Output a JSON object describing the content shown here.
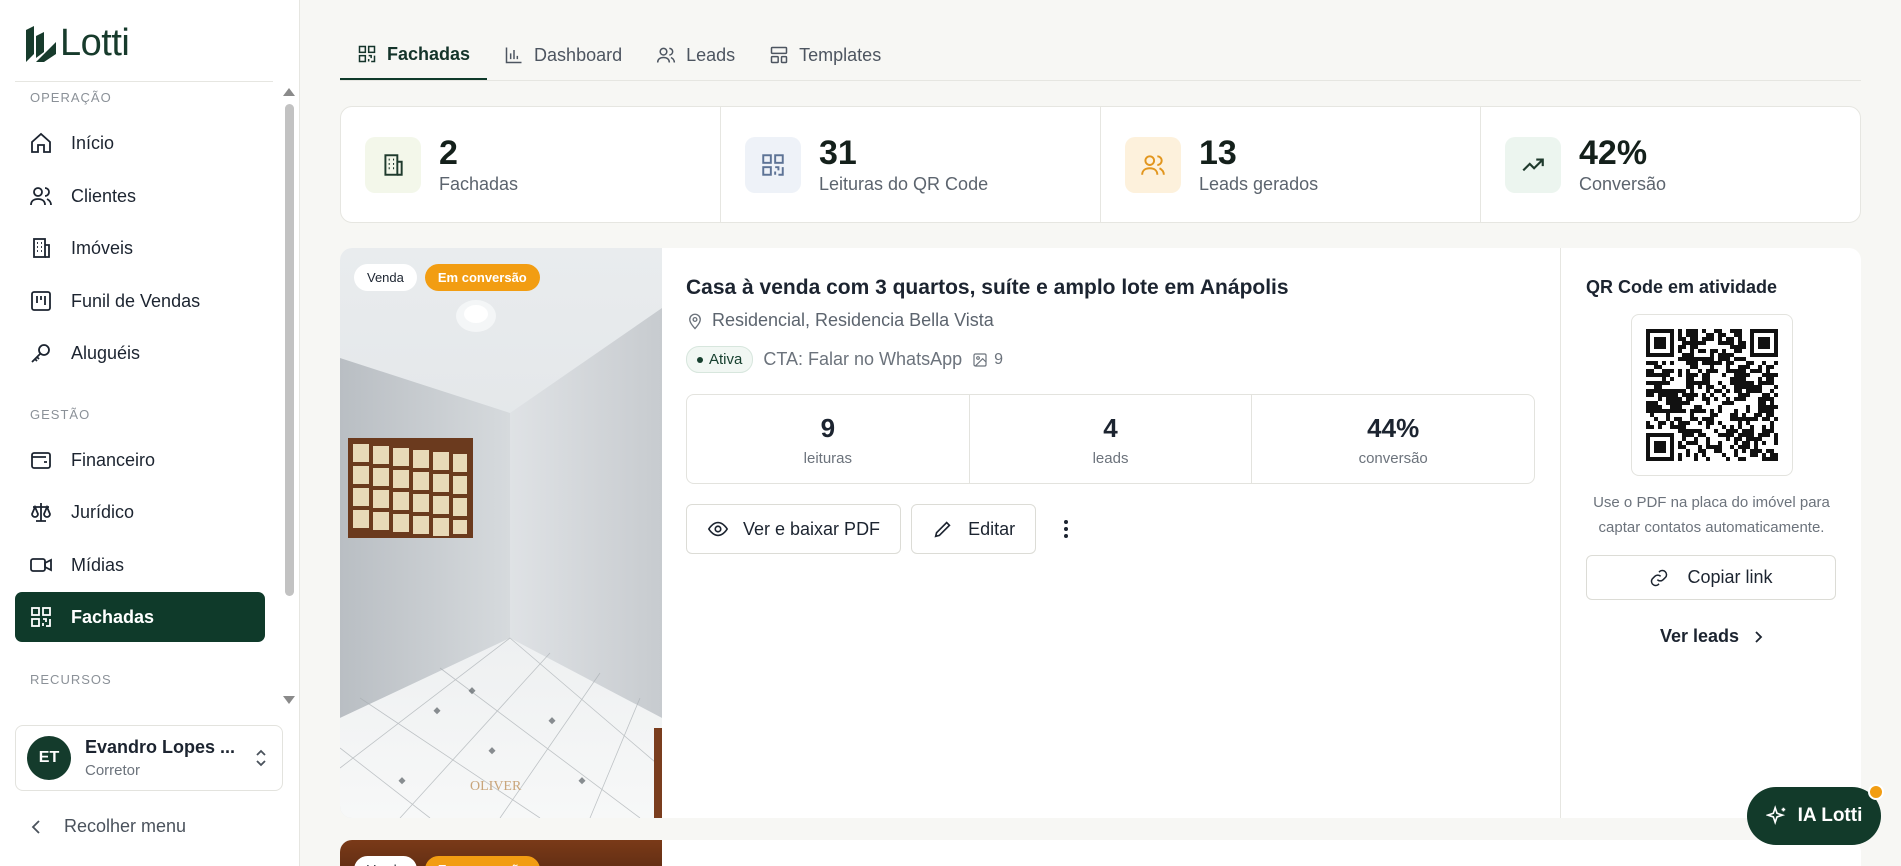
{
  "app": {
    "logo_text": "Lotti"
  },
  "sidebar": {
    "sections": [
      {
        "title": "OPERAÇÃO"
      },
      {
        "title": "GESTÃO"
      },
      {
        "title": "RECURSOS"
      }
    ],
    "items": [
      {
        "label": "Início",
        "icon": "home-icon"
      },
      {
        "label": "Clientes",
        "icon": "users-icon"
      },
      {
        "label": "Imóveis",
        "icon": "building-icon"
      },
      {
        "label": "Funil de Vendas",
        "icon": "kanban-icon"
      },
      {
        "label": "Aluguéis",
        "icon": "key-icon"
      },
      {
        "label": "Financeiro",
        "icon": "wallet-icon"
      },
      {
        "label": "Jurídico",
        "icon": "scale-icon"
      },
      {
        "label": "Mídias",
        "icon": "video-icon"
      },
      {
        "label": "Fachadas",
        "icon": "qr-icon",
        "active": true
      }
    ],
    "user": {
      "initials": "ET",
      "name": "Evandro Lopes ...",
      "role": "Corretor"
    },
    "collapse_label": "Recolher menu"
  },
  "tabs": [
    {
      "label": "Fachadas",
      "active": true
    },
    {
      "label": "Dashboard"
    },
    {
      "label": "Leads"
    },
    {
      "label": "Templates"
    }
  ],
  "stats": [
    {
      "value": "2",
      "label": "Fachadas",
      "color": "#f3f7ea"
    },
    {
      "value": "31",
      "label": "Leituras do QR Code",
      "color": "#eef2f8"
    },
    {
      "value": "13",
      "label": "Leads gerados",
      "color": "#fdf1dc"
    },
    {
      "value": "42%",
      "label": "Conversão",
      "color": "#ecf5ef"
    }
  ],
  "listing": {
    "badges": [
      "Venda",
      "Em conversão"
    ],
    "title": "Casa à venda com 3 quartos, suíte e amplo lote em Anápolis",
    "location": "Residencial, Residencia Bella Vista",
    "status": "Ativa",
    "cta": "CTA: Falar no WhatsApp",
    "photo_count": "9",
    "metrics": [
      {
        "value": "9",
        "label": "leituras"
      },
      {
        "value": "4",
        "label": "leads"
      },
      {
        "value": "44%",
        "label": "conversão"
      }
    ],
    "actions": {
      "pdf": "Ver e baixar PDF",
      "edit": "Editar"
    },
    "photo_watermark": "OLIVER",
    "qr": {
      "title": "QR Code em atividade",
      "help": "Use o PDF na placa do imóvel para captar contatos automaticamente.",
      "copy_label": "Copiar link",
      "leads_label": "Ver leads"
    }
  },
  "listing2": {
    "badges": [
      "Venda",
      "Em conversão"
    ]
  },
  "assistant": {
    "label": "IA Lotti"
  },
  "colors": {
    "brand": "#0f3a2a",
    "accent": "#f29d12"
  }
}
